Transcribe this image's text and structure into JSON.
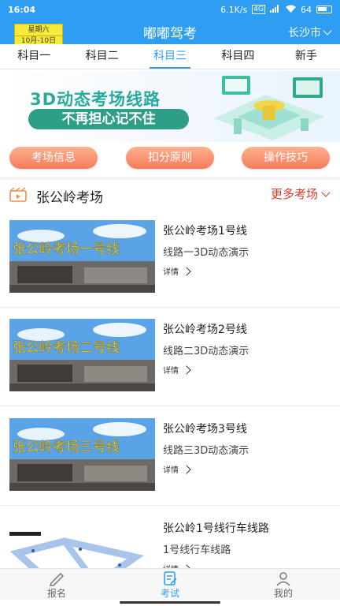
{
  "status": {
    "time": "16:04",
    "speed": "6.1K/s",
    "network": "4G",
    "battery": "64"
  },
  "header": {
    "date_weekday": "星期六",
    "date_day": "10月-10日",
    "title": "嘟嘟驾考",
    "city": "长沙市"
  },
  "tabs": [
    "科目一",
    "科目二",
    "科目三",
    "科目四",
    "新手"
  ],
  "active_tab": "科目三",
  "banner": {
    "title": "3D动态考场线路",
    "subtitle": "不再担心记不住"
  },
  "quick_buttons": [
    "考场信息",
    "扣分原则",
    "操作技巧"
  ],
  "section": {
    "title": "张公岭考场",
    "more": "更多考场"
  },
  "routes": [
    {
      "title": "张公岭考场1号线",
      "subtitle": "线路一3D动态演示",
      "detail": "详情",
      "image_text": "张公岭考场一号线"
    },
    {
      "title": "张公岭考场2号线",
      "subtitle": "线路二3D动态演示",
      "detail": "详情",
      "image_text": "张公岭考场二号线"
    },
    {
      "title": "张公岭考场3号线",
      "subtitle": "线路三3D动态演示",
      "detail": "详情",
      "image_text": "张公岭考场三号线"
    },
    {
      "title": "张公岭1号线行车线路",
      "subtitle": "1号线行车线路",
      "detail": "详情",
      "image_text": ""
    }
  ],
  "bottom_nav": [
    "报名",
    "考试",
    "我的"
  ],
  "active_nav": "考试",
  "colors": {
    "brand": "#2f9ef2",
    "accent_red": "#d93a24",
    "button_orange": "#f57b5a",
    "banner_green": "#2e9e87"
  }
}
